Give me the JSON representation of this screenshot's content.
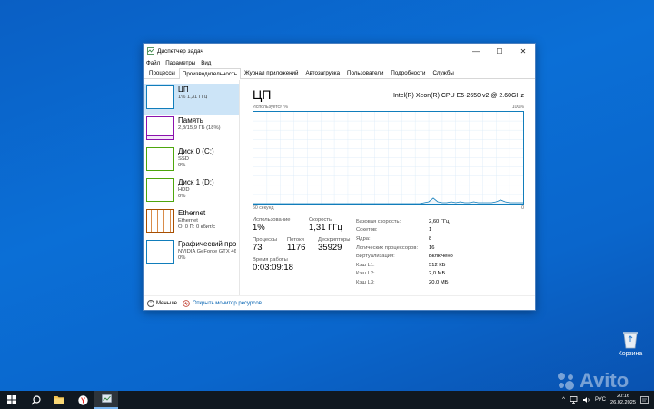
{
  "window": {
    "title": "Диспетчер задач",
    "controls": {
      "minimize": "—",
      "maximize": "☐",
      "close": "✕"
    }
  },
  "menu": [
    "Файл",
    "Параметры",
    "Вид"
  ],
  "tabs": [
    {
      "label": "Процессы",
      "active": false
    },
    {
      "label": "Производительность",
      "active": true
    },
    {
      "label": "Журнал приложений",
      "active": false
    },
    {
      "label": "Автозагрузка",
      "active": false
    },
    {
      "label": "Пользователи",
      "active": false
    },
    {
      "label": "Подробности",
      "active": false
    },
    {
      "label": "Службы",
      "active": false
    }
  ],
  "sidebar": [
    {
      "name": "ЦП",
      "line1": "1% 1,31 ГГц",
      "line2": "",
      "line3": "",
      "color": "#117dbb",
      "selected": true
    },
    {
      "name": "Память",
      "line1": "2,8/15,9 ГБ (18%)",
      "line2": "",
      "line3": "",
      "color": "#8b12ae",
      "selected": false
    },
    {
      "name": "Диск 0 (C:)",
      "line1": "SSD",
      "line2": "0%",
      "line3": "",
      "color": "#4da60c",
      "selected": false
    },
    {
      "name": "Диск 1 (D:)",
      "line1": "HDD",
      "line2": "0%",
      "line3": "",
      "color": "#4da60c",
      "selected": false
    },
    {
      "name": "Ethernet",
      "line1": "Ethernet",
      "line2": "О: 0 П: 0 кбит/с",
      "line3": "",
      "color": "#a74f01",
      "selected": false
    },
    {
      "name": "Графический про",
      "line1": "NVIDIA GeForce GTX 46",
      "line2": "0%",
      "line3": "",
      "color": "#117dbb",
      "selected": false
    }
  ],
  "main": {
    "title": "ЦП",
    "model": "Intel(R) Xeon(R) CPU E5-2650 v2 @ 2.60GHz",
    "graph_label_left": "Используется %",
    "graph_label_right": "100%",
    "graph_bottom_left": "60 секунд",
    "graph_bottom_right": "0",
    "usage_history": [
      0,
      0,
      0,
      0,
      0,
      0,
      0,
      0,
      0,
      0,
      0,
      0,
      0,
      0,
      0,
      0,
      0,
      0,
      0,
      0,
      0,
      0,
      0,
      0,
      0,
      0,
      0,
      0,
      0,
      0,
      0,
      0,
      0,
      0,
      0,
      0,
      0,
      0,
      1,
      2,
      6,
      2,
      1,
      1,
      2,
      1,
      2,
      1,
      1,
      2,
      1,
      1,
      1,
      1,
      2,
      4,
      2,
      1,
      1,
      1,
      1
    ]
  },
  "stats": {
    "usage_label": "Использование",
    "usage_value": "1%",
    "speed_label": "Скорость",
    "speed_value": "1,31 ГГц",
    "proc_label": "Процессы",
    "proc_value": "73",
    "threads_label": "Потоки",
    "threads_value": "1176",
    "handles_label": "Дескрипторы",
    "handles_value": "35929",
    "uptime_label": "Время работы",
    "uptime_value": "0:03:09:18"
  },
  "specs": [
    {
      "k": "Базовая скорость:",
      "v": "2,60 ГГц"
    },
    {
      "k": "Сокетов:",
      "v": "1"
    },
    {
      "k": "Ядра:",
      "v": "8"
    },
    {
      "k": "Логических процессоров:",
      "v": "16"
    },
    {
      "k": "Виртуализация:",
      "v": "Включено"
    },
    {
      "k": "Кэш L1:",
      "v": "512 КБ"
    },
    {
      "k": "Кэш L2:",
      "v": "2,0 МБ"
    },
    {
      "k": "Кэш L3:",
      "v": "20,0 МБ"
    }
  ],
  "footer": {
    "fewer": "Меньше",
    "monitor": "Открыть монитор ресурсов"
  },
  "desktop": {
    "recycle_bin": "Корзина",
    "watermark": "Avito"
  },
  "taskbar": {
    "lang": "РУС",
    "time": "20:16",
    "date": "26.02.2025"
  }
}
